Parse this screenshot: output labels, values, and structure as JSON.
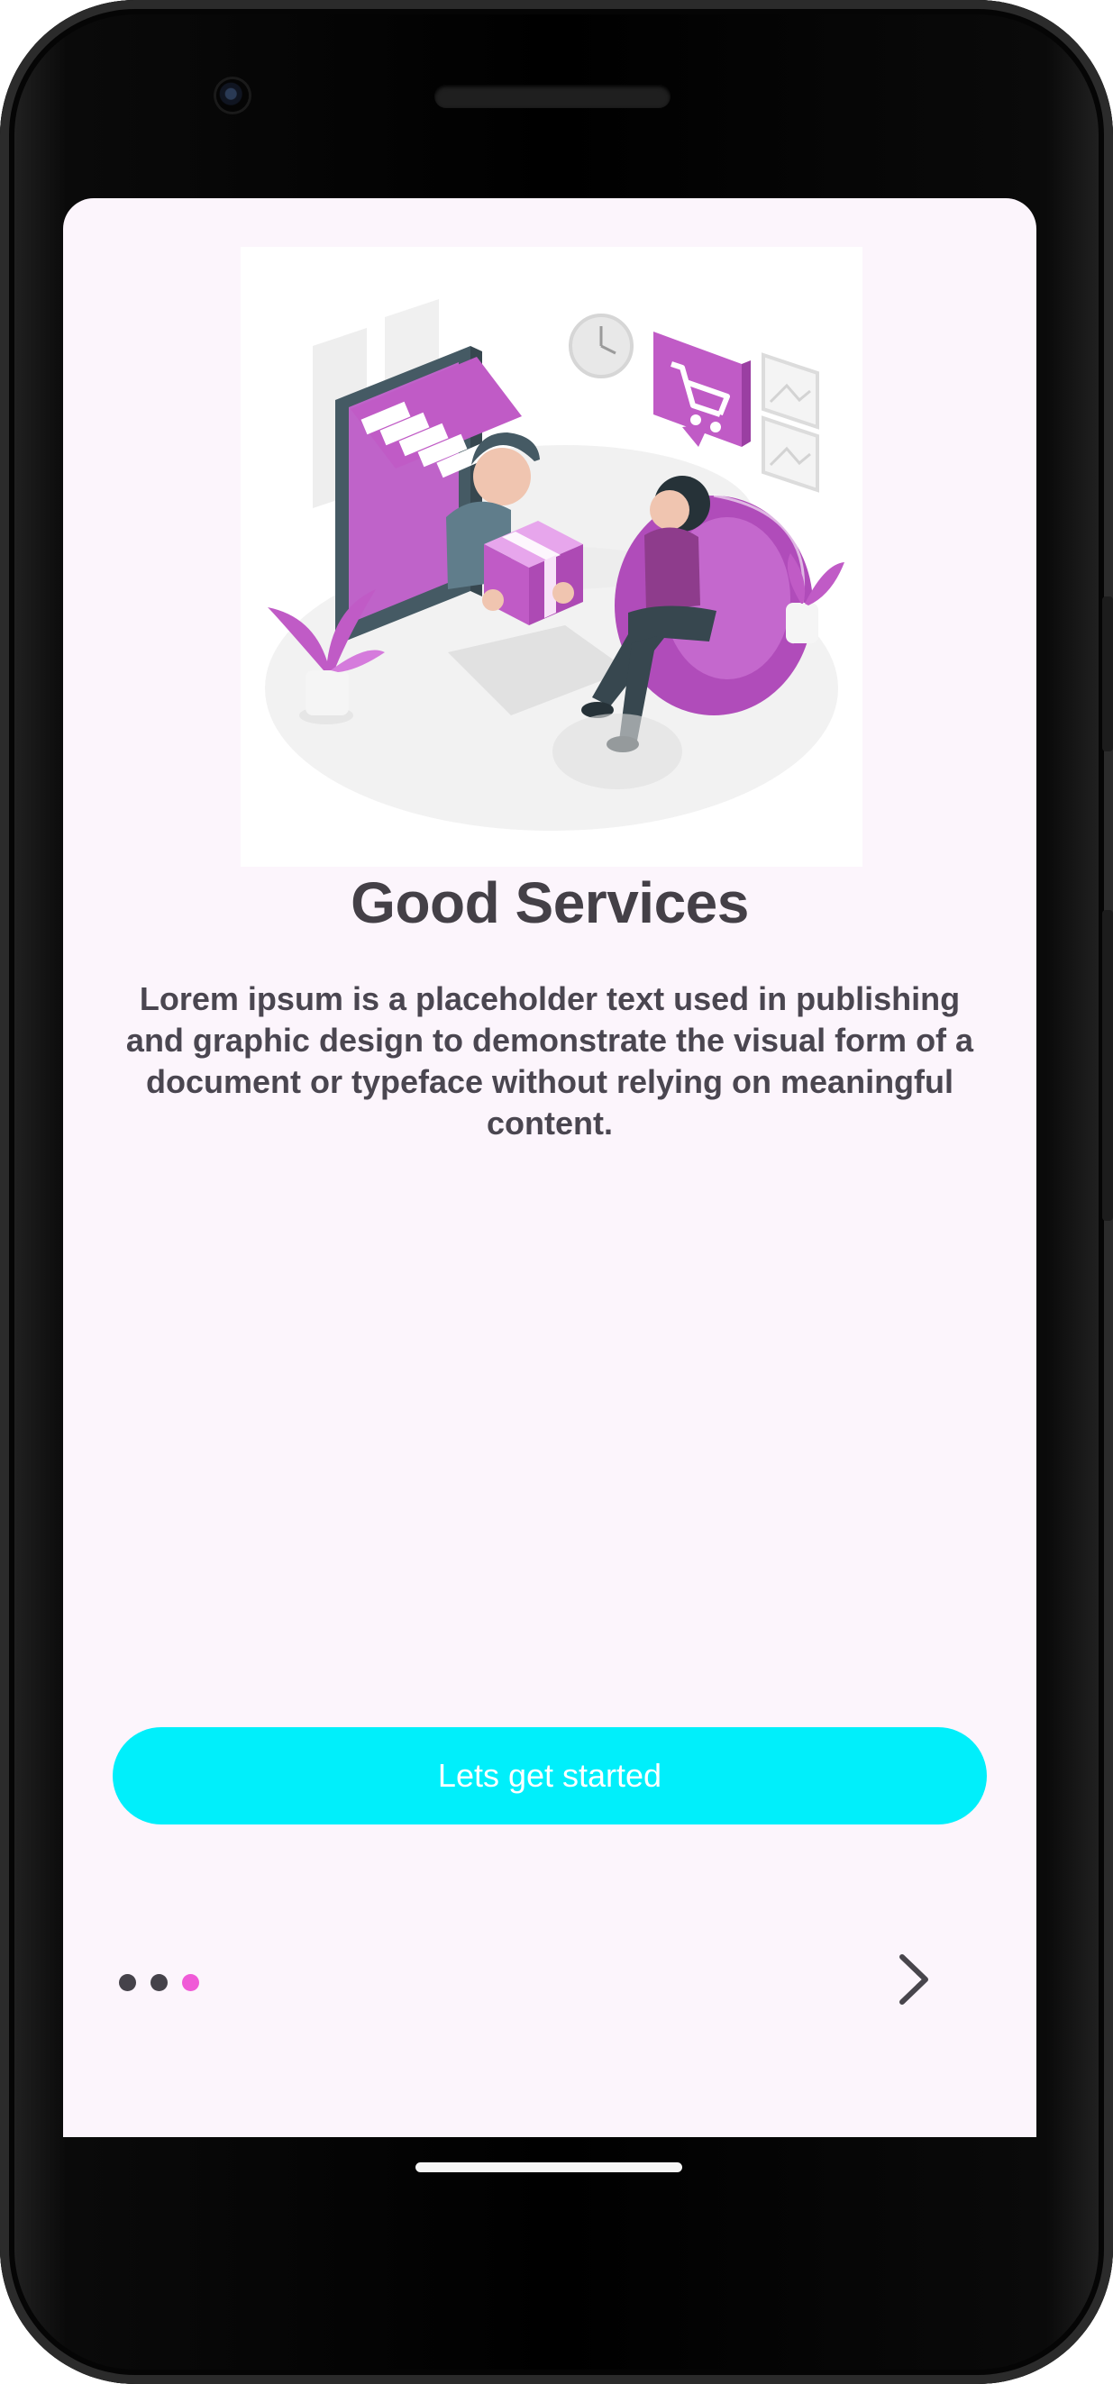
{
  "onboarding": {
    "title": "Good Services",
    "description": "Lorem ipsum is a placeholder text used in publishing and graphic design to demonstrate the visual form of a document or typeface without relying on meaningful content.",
    "cta_label": "Lets get started",
    "page_indicator": {
      "total": 3,
      "current": 3
    },
    "next_icon": "chevron-right-icon",
    "illustration": "online-shopping-delivery-illustration"
  },
  "colors": {
    "screen_background": "#fcf5fc",
    "accent": "#00effb",
    "active_dot": "#f05ad7",
    "inactive_dot": "#45424a",
    "text": "#444047",
    "illustration_purple": "#c05bc6"
  }
}
